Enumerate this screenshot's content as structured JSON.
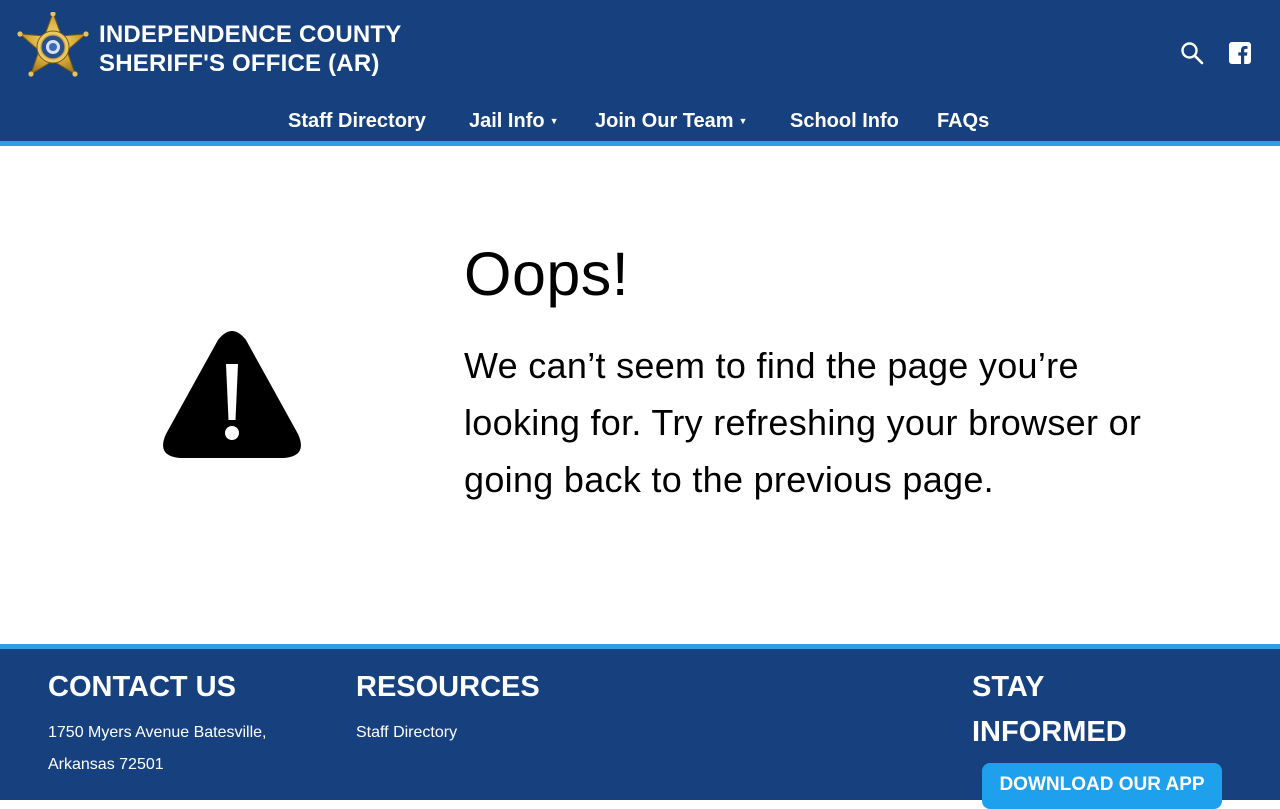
{
  "header": {
    "title_line1": "INDEPENDENCE COUNTY",
    "title_line2": "SHERIFF'S OFFICE (AR)",
    "badge_icon": "sheriff-star-badge-icon",
    "search_icon": "search-icon",
    "social_icon": "facebook-icon",
    "bg_color": "#17417e",
    "accent_color": "#2e9ee8"
  },
  "nav": {
    "items": [
      {
        "label": "Staff Directory",
        "has_dropdown": false
      },
      {
        "label": "Jail Info",
        "has_dropdown": true
      },
      {
        "label": "Join Our Team",
        "has_dropdown": true
      },
      {
        "label": "School Info",
        "has_dropdown": false
      },
      {
        "label": "FAQs",
        "has_dropdown": false
      }
    ]
  },
  "main": {
    "icon": "warning-triangle-icon",
    "heading": "Oops!",
    "message": "We can’t seem to find the page you’re looking for. Try refreshing your browser or going back to the previous page."
  },
  "footer": {
    "contact": {
      "heading": "CONTACT US",
      "address_line1": "1750 Myers Avenue Batesville,",
      "address_line2": "Arkansas 72501"
    },
    "resources": {
      "heading": "RESOURCES",
      "links": [
        "Staff Directory"
      ]
    },
    "stay_informed": {
      "heading_line1": "STAY",
      "heading_line2": "INFORMED",
      "button_label": "DOWNLOAD OUR APP",
      "button_color": "#1ea0ec"
    }
  }
}
